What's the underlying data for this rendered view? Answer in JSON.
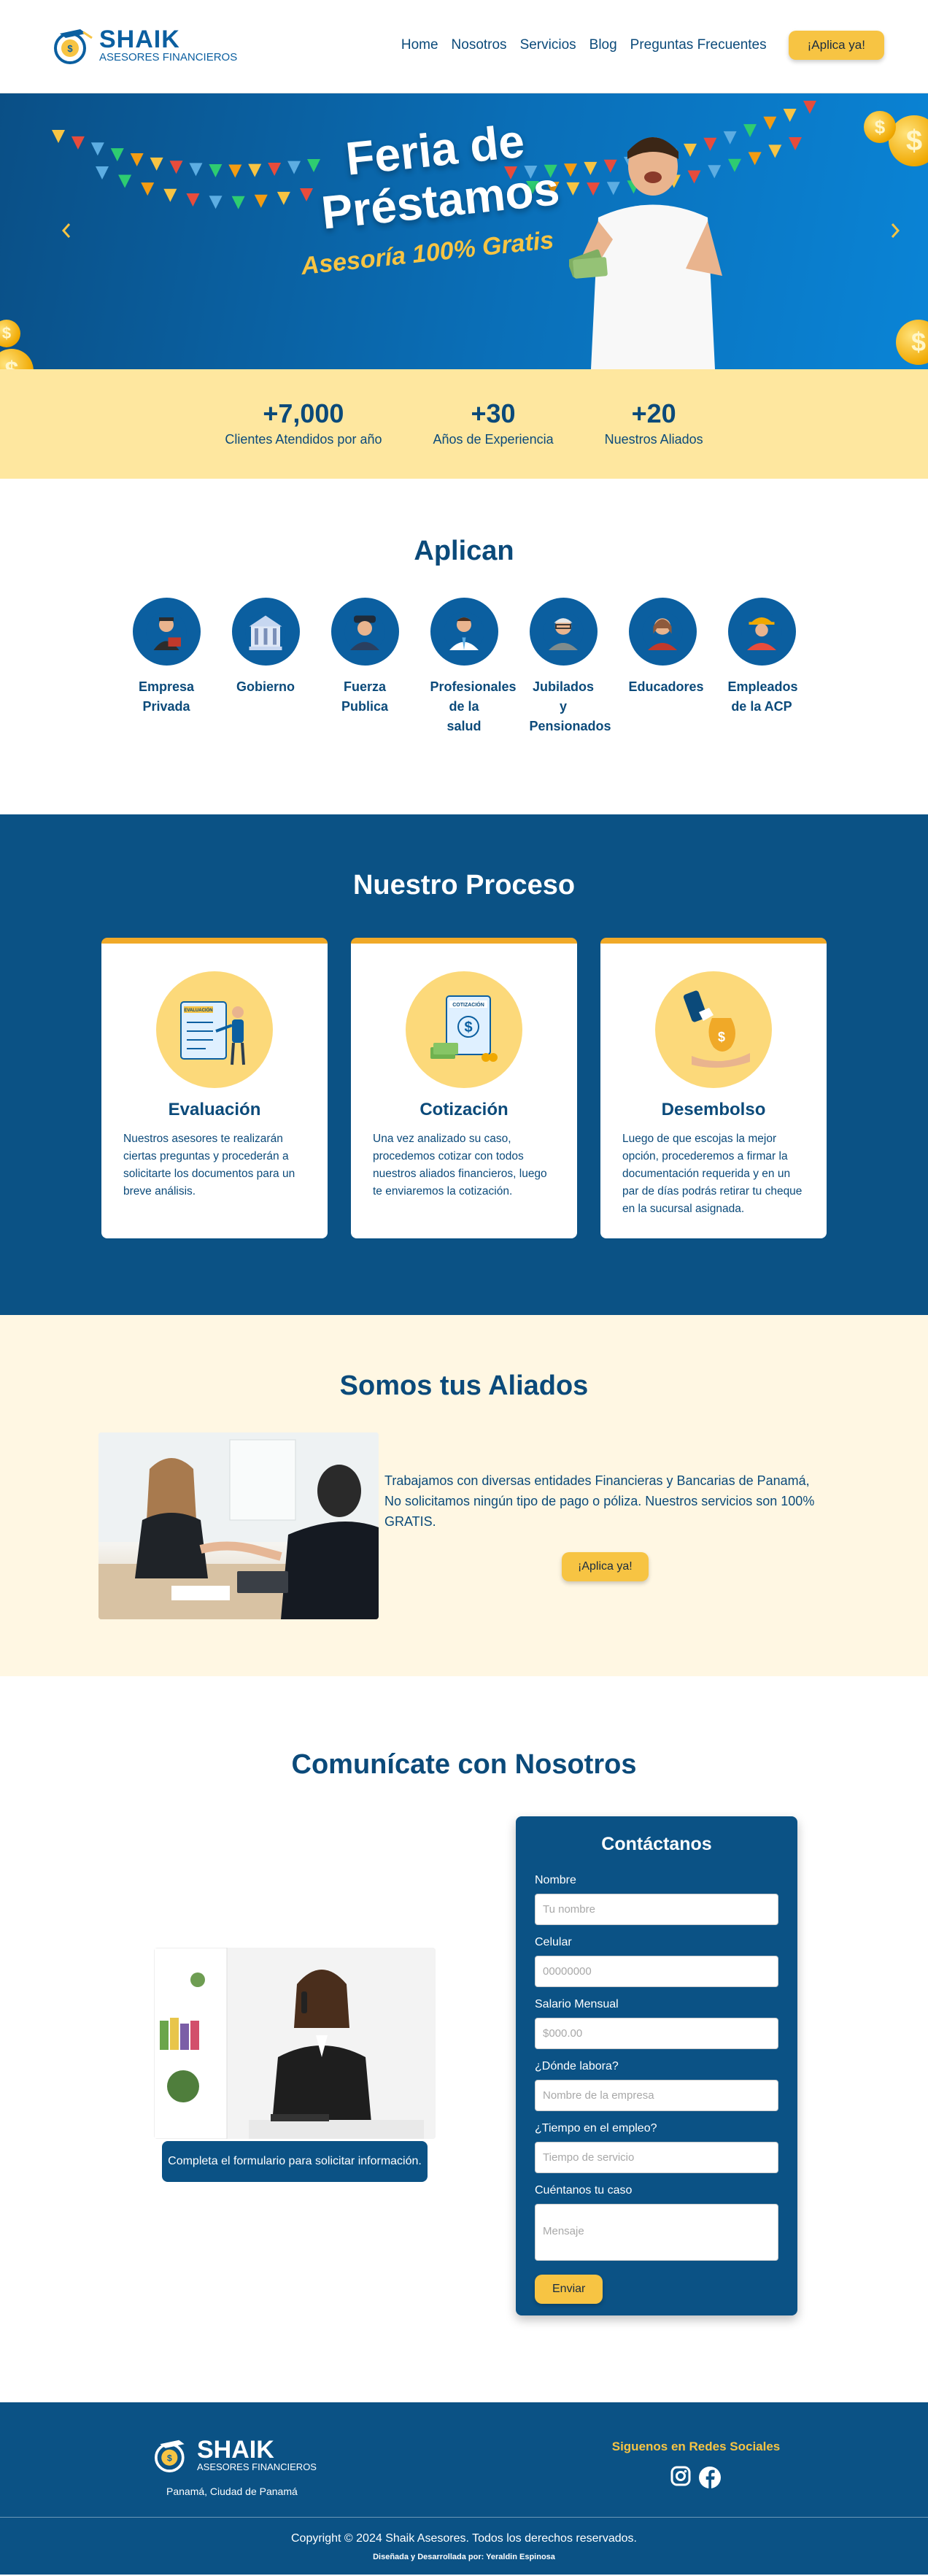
{
  "header": {
    "brand": "SHAIK",
    "brand_sub": "ASESORES FINANCIEROS",
    "nav": [
      "Home",
      "Nosotros",
      "Servicios",
      "Blog",
      "Preguntas Frecuentes"
    ],
    "cta": "¡Aplica ya!"
  },
  "hero": {
    "title": "Feria de Préstamos",
    "subtitle": "Asesoría 100% Gratis",
    "prev_icon": "chevron-left-icon",
    "next_icon": "chevron-right-icon"
  },
  "stats": [
    {
      "value": "+7,000",
      "label": "Clientes Atendidos por año"
    },
    {
      "value": "+30",
      "label": "Años de Experiencia"
    },
    {
      "value": "+20",
      "label": "Nuestros Aliados"
    }
  ],
  "aplican": {
    "title": "Aplican",
    "categories": [
      {
        "label": "Empresa Privada",
        "icon": "businessman-icon"
      },
      {
        "label": "Gobierno",
        "icon": "government-building-icon"
      },
      {
        "label": "Fuerza Publica",
        "icon": "police-officer-icon"
      },
      {
        "label": "Profesionales de la salud",
        "icon": "doctor-icon"
      },
      {
        "label": "Jubilados y Pensionados",
        "icon": "retiree-icon"
      },
      {
        "label": "Educadores",
        "icon": "teacher-icon"
      },
      {
        "label": "Empleados de la ACP",
        "icon": "construction-worker-icon"
      }
    ]
  },
  "proceso": {
    "title": "Nuestro Proceso",
    "steps": [
      {
        "title": "Evaluación",
        "text": "Nuestros asesores te realizarán ciertas preguntas y procederán a solicitarte los documentos para un breve análisis.",
        "badge": "EVALUACIÓN"
      },
      {
        "title": "Cotización",
        "text": "Una vez analizado su caso, procedemos cotizar con todos nuestros aliados financieros, luego te enviaremos la cotización.",
        "badge": "COTIZACIÓN"
      },
      {
        "title": "Desembolso",
        "text": "Luego de que escojas la mejor opción, procederemos a firmar la documentación requerida y en un par de días podrás retirar tu cheque en la sucursal asignada."
      }
    ]
  },
  "aliados": {
    "title": "Somos tus Aliados",
    "text": "Trabajamos con diversas entidades Financieras y Bancarias de Panamá, No solicitamos ningún tipo de pago o póliza. Nuestros servicios son 100% GRATIS.",
    "cta": "¡Aplica ya!"
  },
  "contacto": {
    "title": "Comunícate con Nosotros",
    "caption": "Completa el formulario para solicitar información.",
    "form_title": "Contáctanos",
    "fields": [
      {
        "label": "Nombre",
        "placeholder": "Tu nombre"
      },
      {
        "label": "Celular",
        "placeholder": "00000000"
      },
      {
        "label": "Salario Mensual",
        "placeholder": "$000.00"
      },
      {
        "label": "¿Dónde labora?",
        "placeholder": "Nombre de la empresa"
      },
      {
        "label": "¿Tiempo en el empleo?",
        "placeholder": "Tiempo de servicio"
      }
    ],
    "message_label": "Cuéntanos tu caso",
    "message_placeholder": "Mensaje",
    "submit": "Enviar"
  },
  "footer": {
    "brand": "SHAIK",
    "brand_sub": "ASESORES FINANCIEROS",
    "location": "Panamá, Ciudad de Panamá",
    "social_title": "Siguenos en Redes Sociales",
    "social": [
      "instagram-icon",
      "facebook-icon"
    ],
    "copyright": "Copyright © 2024 Shaik Asesores. Todos los derechos reservados.",
    "credit": "Diseñada y Desarrollada por: Yeraldin Espinosa"
  },
  "colors": {
    "navy": "#0b5285",
    "yellow": "#f7c443",
    "cream": "#fee79f",
    "orange": "#f0a928"
  }
}
